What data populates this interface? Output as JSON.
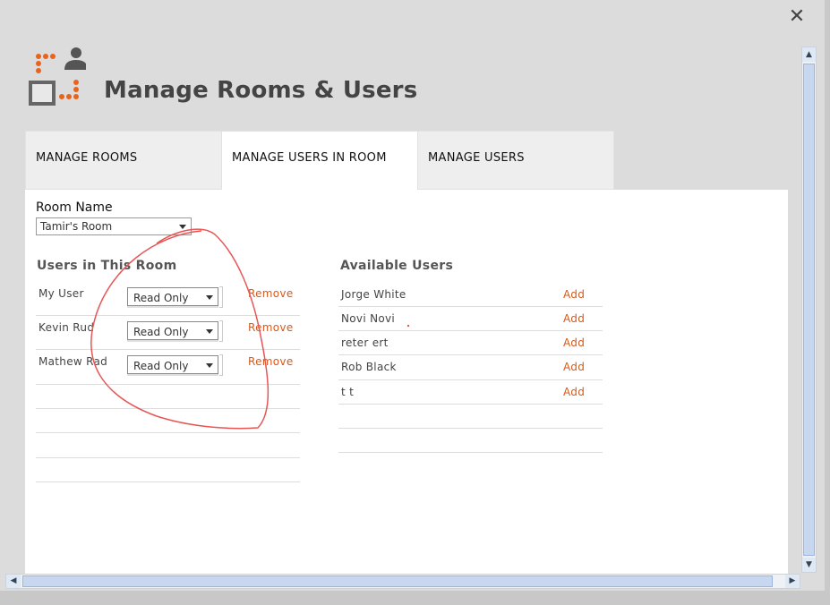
{
  "dialog": {
    "title": "Manage Rooms & Users",
    "close_symbol": "✕"
  },
  "tabs": [
    {
      "label": "MANAGE ROOMS",
      "active": false
    },
    {
      "label": "MANAGE USERS IN ROOM",
      "active": true
    },
    {
      "label": "MANAGE USERS",
      "active": false
    }
  ],
  "room": {
    "label": "Room Name",
    "selected": "Tamir's Room"
  },
  "users_in_room": {
    "title": "Users in This Room",
    "rows": [
      {
        "name": "My User",
        "permission": "Read Only",
        "action": "Remove"
      },
      {
        "name": "Kevin Rud",
        "permission": "Read Only",
        "action": "Remove"
      },
      {
        "name": "Mathew Rad",
        "permission": "Read Only",
        "action": "Remove"
      }
    ]
  },
  "available_users": {
    "title": "Available Users",
    "rows": [
      {
        "name": "Jorge White",
        "action": "Add"
      },
      {
        "name": "Novi Novi",
        "action": "Add"
      },
      {
        "name": "reter ert",
        "action": "Add"
      },
      {
        "name": "Rob Black",
        "action": "Add"
      },
      {
        "name": "t t",
        "action": "Add"
      }
    ]
  },
  "colors": {
    "accent_orange": "#d55a1a",
    "annotation_red": "#e85555",
    "logo_orange": "#e8641c"
  },
  "icons": {
    "logo": "rooms-users-logo-icon",
    "close": "close-icon"
  }
}
